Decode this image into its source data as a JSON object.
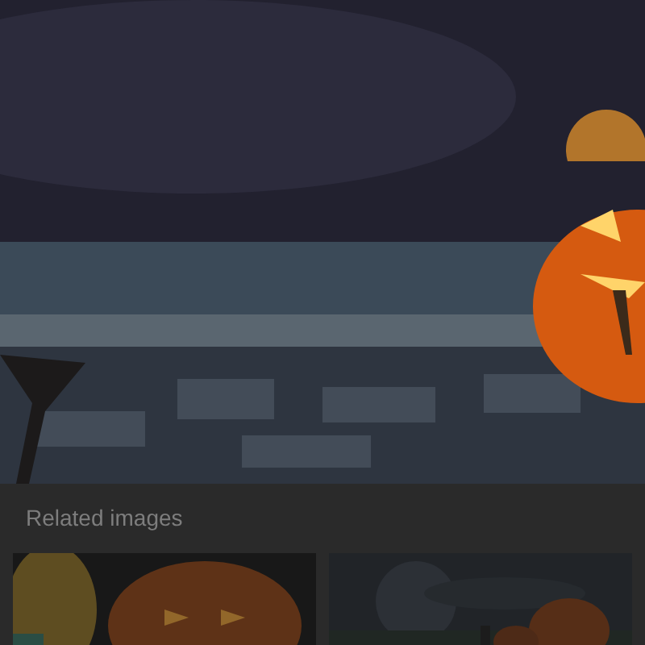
{
  "related": {
    "title": "Related images"
  }
}
